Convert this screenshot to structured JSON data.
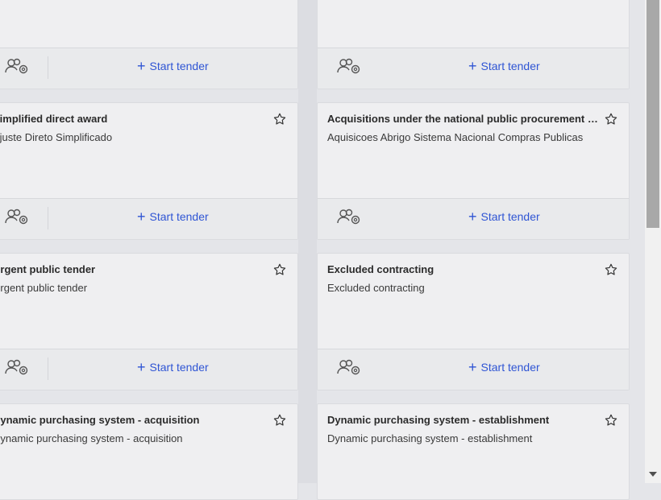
{
  "cards": [
    {
      "title": "",
      "subtitle": "",
      "start_label": "Start tender"
    },
    {
      "title": "",
      "subtitle": "",
      "start_label": "Start tender"
    },
    {
      "title": "Simplified direct award",
      "subtitle": "Ajuste Direto Simplificado",
      "start_label": "Start tender"
    },
    {
      "title": "Acquisitions under the national public procurement sys...",
      "subtitle": "Aquisicoes Abrigo Sistema Nacional Compras Publicas",
      "start_label": "Start tender"
    },
    {
      "title": "Urgent public tender",
      "subtitle": "Urgent public tender",
      "start_label": "Start tender"
    },
    {
      "title": "Excluded contracting",
      "subtitle": "Excluded contracting",
      "start_label": "Start tender"
    },
    {
      "title": "Dynamic purchasing system - acquisition",
      "subtitle": "Dynamic purchasing system - acquisition",
      "start_label": ""
    },
    {
      "title": "Dynamic purchasing system - establishment",
      "subtitle": "Dynamic purchasing system - establishment",
      "start_label": ""
    }
  ],
  "icons": {
    "star": "star-outline-icon",
    "team": "team-settings-icon",
    "plus": "plus-icon"
  },
  "colors": {
    "accent": "#2f55d4",
    "background": "#e4e5e9",
    "card": "#efeff1"
  }
}
